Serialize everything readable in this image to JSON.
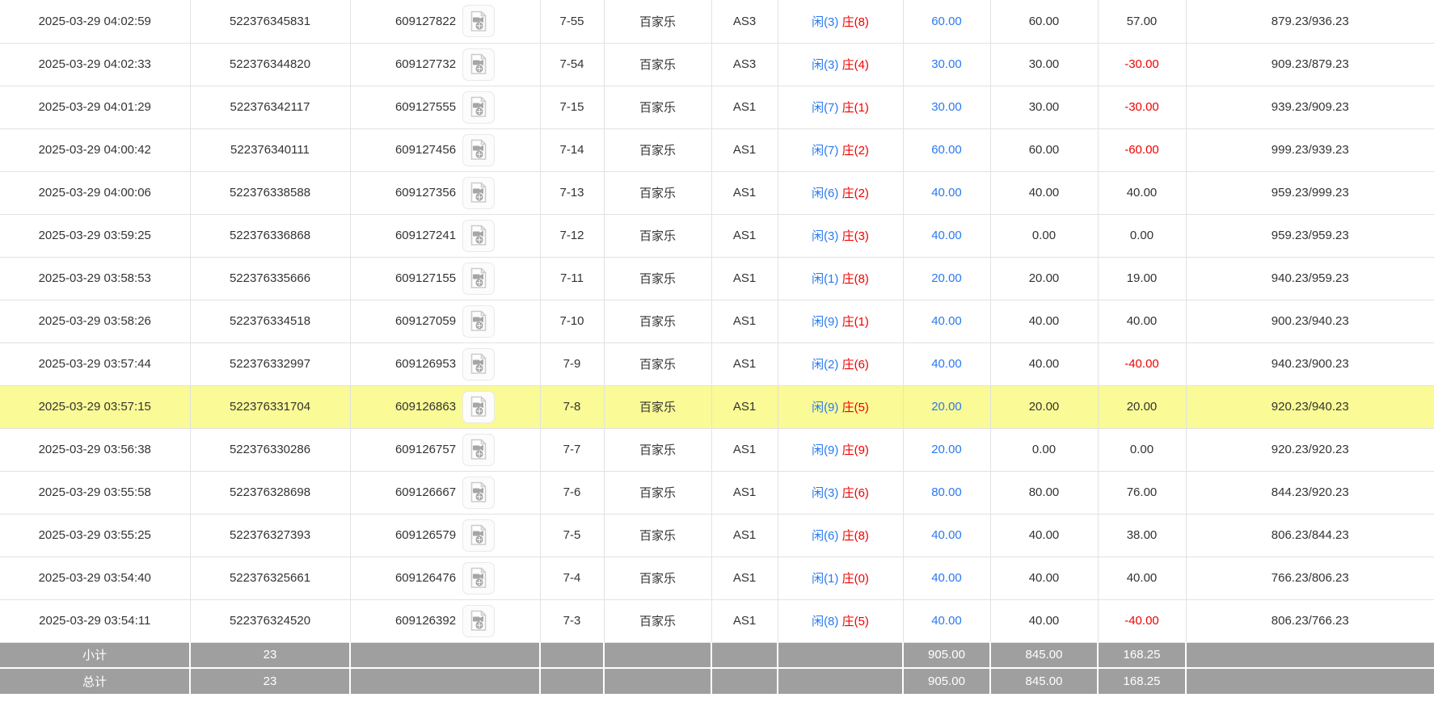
{
  "colors": {
    "link_blue": "#2979f2",
    "loss_red": "#f10000",
    "highlight_yellow": "#fafa96",
    "summary_gray": "#9f9f9f",
    "row_border": "#e2e2e2",
    "text": "#333333"
  },
  "icons": {
    "video_replay": "document-video-icon"
  },
  "table": {
    "rows": [
      {
        "time": "2025-03-29 04:02:59",
        "bet_id": "522376345831",
        "round_id": "609127822",
        "shoe_round": "7-55",
        "game": "百家乐",
        "table_name": "AS3",
        "player_result": "闲(3)",
        "banker_result": "庄(8)",
        "bet_amount": "60.00",
        "valid_amount": "60.00",
        "win_loss": "57.00",
        "balance": "879.23/936.23",
        "highlighted": false
      },
      {
        "time": "2025-03-29 04:02:33",
        "bet_id": "522376344820",
        "round_id": "609127732",
        "shoe_round": "7-54",
        "game": "百家乐",
        "table_name": "AS3",
        "player_result": "闲(3)",
        "banker_result": "庄(4)",
        "bet_amount": "30.00",
        "valid_amount": "30.00",
        "win_loss": "-30.00",
        "balance": "909.23/879.23",
        "highlighted": false
      },
      {
        "time": "2025-03-29 04:01:29",
        "bet_id": "522376342117",
        "round_id": "609127555",
        "shoe_round": "7-15",
        "game": "百家乐",
        "table_name": "AS1",
        "player_result": "闲(7)",
        "banker_result": "庄(1)",
        "bet_amount": "30.00",
        "valid_amount": "30.00",
        "win_loss": "-30.00",
        "balance": "939.23/909.23",
        "highlighted": false
      },
      {
        "time": "2025-03-29 04:00:42",
        "bet_id": "522376340111",
        "round_id": "609127456",
        "shoe_round": "7-14",
        "game": "百家乐",
        "table_name": "AS1",
        "player_result": "闲(7)",
        "banker_result": "庄(2)",
        "bet_amount": "60.00",
        "valid_amount": "60.00",
        "win_loss": "-60.00",
        "balance": "999.23/939.23",
        "highlighted": false
      },
      {
        "time": "2025-03-29 04:00:06",
        "bet_id": "522376338588",
        "round_id": "609127356",
        "shoe_round": "7-13",
        "game": "百家乐",
        "table_name": "AS1",
        "player_result": "闲(6)",
        "banker_result": "庄(2)",
        "bet_amount": "40.00",
        "valid_amount": "40.00",
        "win_loss": "40.00",
        "balance": "959.23/999.23",
        "highlighted": false
      },
      {
        "time": "2025-03-29 03:59:25",
        "bet_id": "522376336868",
        "round_id": "609127241",
        "shoe_round": "7-12",
        "game": "百家乐",
        "table_name": "AS1",
        "player_result": "闲(3)",
        "banker_result": "庄(3)",
        "bet_amount": "40.00",
        "valid_amount": "0.00",
        "win_loss": "0.00",
        "balance": "959.23/959.23",
        "highlighted": false
      },
      {
        "time": "2025-03-29 03:58:53",
        "bet_id": "522376335666",
        "round_id": "609127155",
        "shoe_round": "7-11",
        "game": "百家乐",
        "table_name": "AS1",
        "player_result": "闲(1)",
        "banker_result": "庄(8)",
        "bet_amount": "20.00",
        "valid_amount": "20.00",
        "win_loss": "19.00",
        "balance": "940.23/959.23",
        "highlighted": false
      },
      {
        "time": "2025-03-29 03:58:26",
        "bet_id": "522376334518",
        "round_id": "609127059",
        "shoe_round": "7-10",
        "game": "百家乐",
        "table_name": "AS1",
        "player_result": "闲(9)",
        "banker_result": "庄(1)",
        "bet_amount": "40.00",
        "valid_amount": "40.00",
        "win_loss": "40.00",
        "balance": "900.23/940.23",
        "highlighted": false
      },
      {
        "time": "2025-03-29 03:57:44",
        "bet_id": "522376332997",
        "round_id": "609126953",
        "shoe_round": "7-9",
        "game": "百家乐",
        "table_name": "AS1",
        "player_result": "闲(2)",
        "banker_result": "庄(6)",
        "bet_amount": "40.00",
        "valid_amount": "40.00",
        "win_loss": "-40.00",
        "balance": "940.23/900.23",
        "highlighted": false
      },
      {
        "time": "2025-03-29 03:57:15",
        "bet_id": "522376331704",
        "round_id": "609126863",
        "shoe_round": "7-8",
        "game": "百家乐",
        "table_name": "AS1",
        "player_result": "闲(9)",
        "banker_result": "庄(5)",
        "bet_amount": "20.00",
        "valid_amount": "20.00",
        "win_loss": "20.00",
        "balance": "920.23/940.23",
        "highlighted": true
      },
      {
        "time": "2025-03-29 03:56:38",
        "bet_id": "522376330286",
        "round_id": "609126757",
        "shoe_round": "7-7",
        "game": "百家乐",
        "table_name": "AS1",
        "player_result": "闲(9)",
        "banker_result": "庄(9)",
        "bet_amount": "20.00",
        "valid_amount": "0.00",
        "win_loss": "0.00",
        "balance": "920.23/920.23",
        "highlighted": false
      },
      {
        "time": "2025-03-29 03:55:58",
        "bet_id": "522376328698",
        "round_id": "609126667",
        "shoe_round": "7-6",
        "game": "百家乐",
        "table_name": "AS1",
        "player_result": "闲(3)",
        "banker_result": "庄(6)",
        "bet_amount": "80.00",
        "valid_amount": "80.00",
        "win_loss": "76.00",
        "balance": "844.23/920.23",
        "highlighted": false
      },
      {
        "time": "2025-03-29 03:55:25",
        "bet_id": "522376327393",
        "round_id": "609126579",
        "shoe_round": "7-5",
        "game": "百家乐",
        "table_name": "AS1",
        "player_result": "闲(6)",
        "banker_result": "庄(8)",
        "bet_amount": "40.00",
        "valid_amount": "40.00",
        "win_loss": "38.00",
        "balance": "806.23/844.23",
        "highlighted": false
      },
      {
        "time": "2025-03-29 03:54:40",
        "bet_id": "522376325661",
        "round_id": "609126476",
        "shoe_round": "7-4",
        "game": "百家乐",
        "table_name": "AS1",
        "player_result": "闲(1)",
        "banker_result": "庄(0)",
        "bet_amount": "40.00",
        "valid_amount": "40.00",
        "win_loss": "40.00",
        "balance": "766.23/806.23",
        "highlighted": false
      },
      {
        "time": "2025-03-29 03:54:11",
        "bet_id": "522376324520",
        "round_id": "609126392",
        "shoe_round": "7-3",
        "game": "百家乐",
        "table_name": "AS1",
        "player_result": "闲(8)",
        "banker_result": "庄(5)",
        "bet_amount": "40.00",
        "valid_amount": "40.00",
        "win_loss": "-40.00",
        "balance": "806.23/766.23",
        "highlighted": false
      }
    ],
    "summary": {
      "subtotal": {
        "label": "小计",
        "count": "23",
        "bet_total": "905.00",
        "valid_total": "845.00",
        "winloss_total": "168.25"
      },
      "total": {
        "label": "总计",
        "count": "23",
        "bet_total": "905.00",
        "valid_total": "845.00",
        "winloss_total": "168.25"
      }
    }
  }
}
